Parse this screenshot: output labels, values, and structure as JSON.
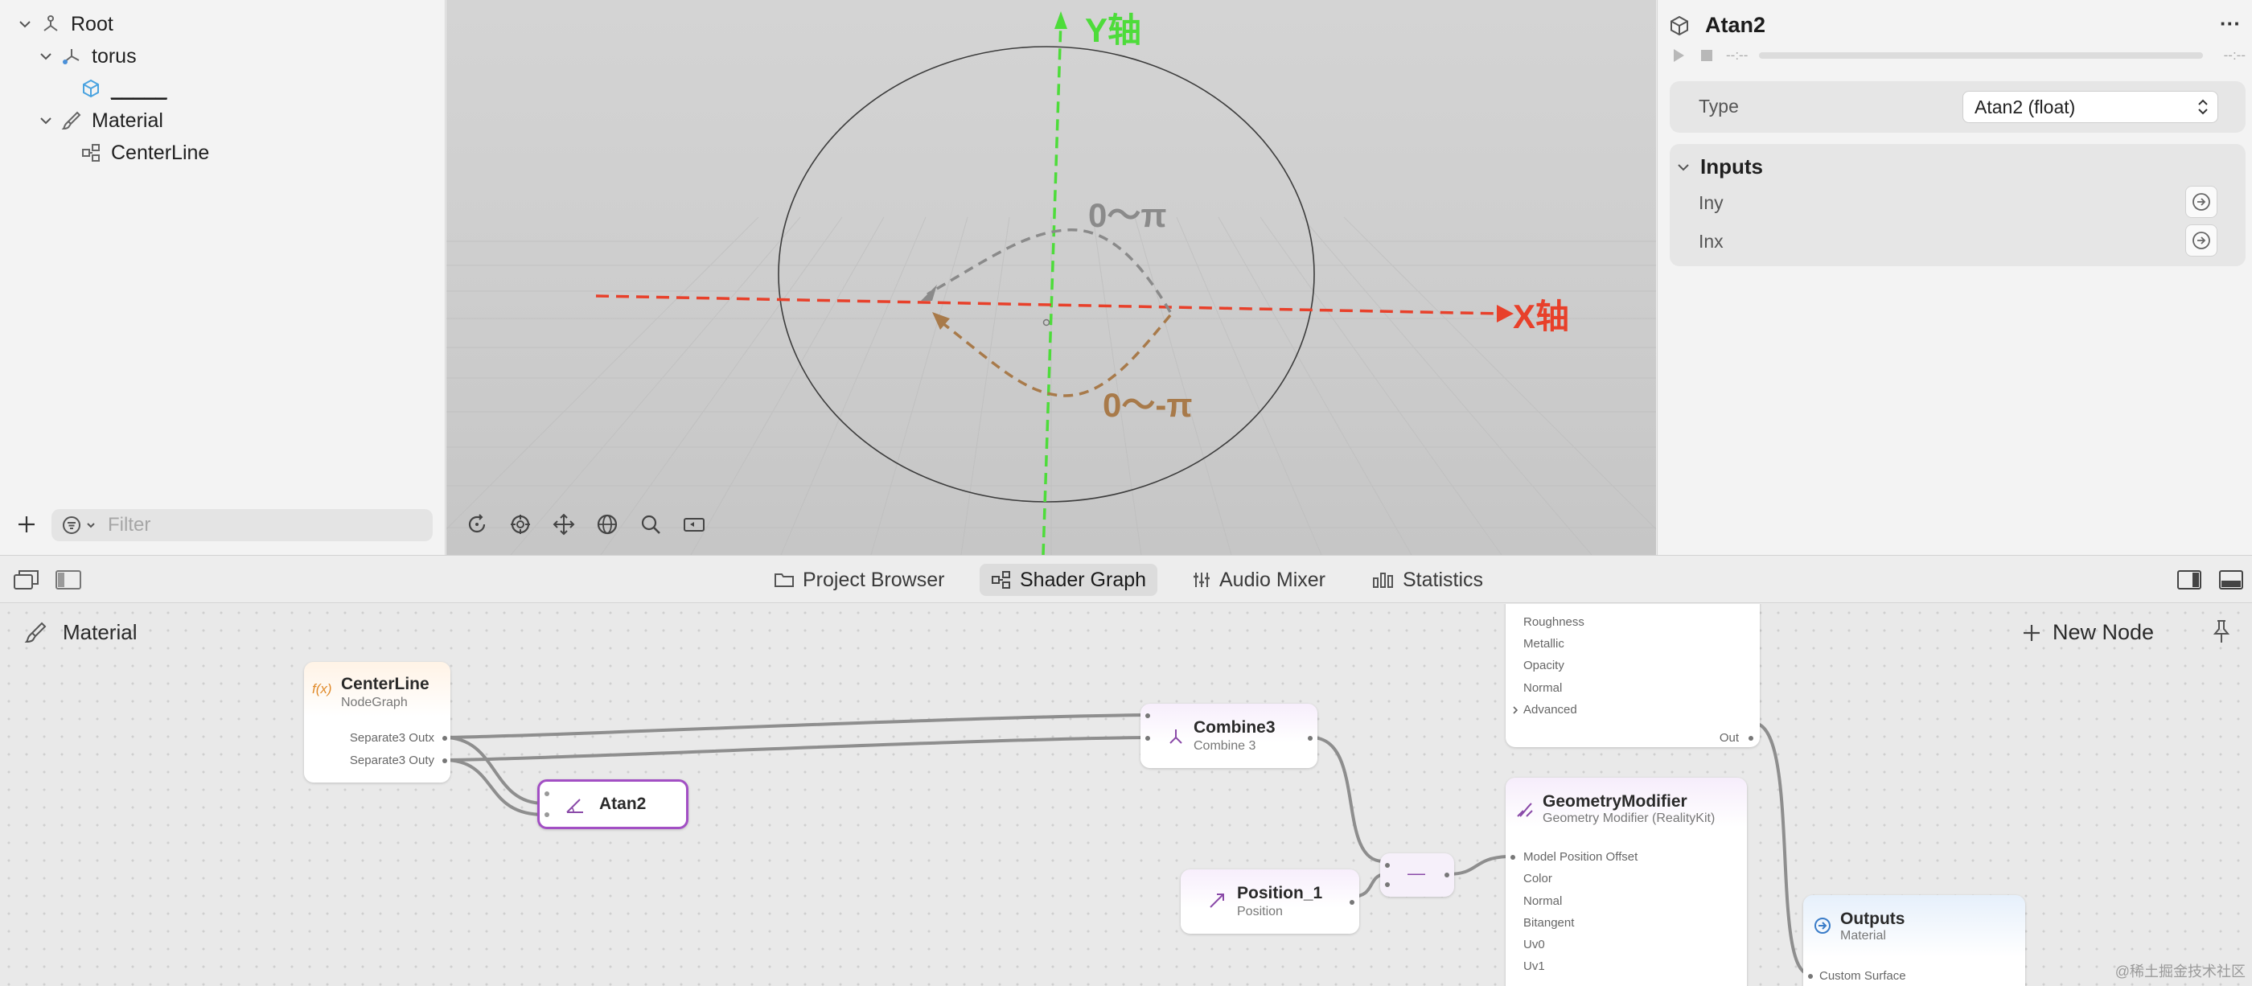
{
  "hierarchy": {
    "items": [
      {
        "label": "Root"
      },
      {
        "label": "torus"
      },
      {
        "label": "_____"
      },
      {
        "label": "Material"
      },
      {
        "label": "CenterLine"
      }
    ],
    "filter_placeholder": "Filter"
  },
  "viewport": {
    "y_axis_label": "Y轴",
    "x_axis_label": "X轴",
    "upper_range_label": "0～π",
    "lower_range_label": "0～-π",
    "colors": {
      "x_axis": "#e8402a",
      "y_axis": "#4ddc3a",
      "upper_arc": "#8a8a8a",
      "lower_arc": "#a87a4a"
    }
  },
  "inspector": {
    "title": "Atan2",
    "more_label": "···",
    "time_start": "--:--",
    "time_end": "--:--",
    "type_label": "Type",
    "type_value": "Atan2 (float)",
    "inputs_header": "Inputs",
    "inputs": [
      {
        "label": "Iny"
      },
      {
        "label": "Inx"
      }
    ]
  },
  "tabs": [
    {
      "label": "Project Browser"
    },
    {
      "label": "Shader Graph"
    },
    {
      "label": "Audio Mixer"
    },
    {
      "label": "Statistics"
    }
  ],
  "graph": {
    "breadcrumb": "Material",
    "new_node_label": "New Node",
    "nodes": {
      "centerline": {
        "icon_text": "f(x)",
        "title": "CenterLine",
        "subtitle": "NodeGraph",
        "ports": [
          "Separate3 Outx",
          "Separate3 Outy"
        ]
      },
      "atan2": {
        "title": "Atan2"
      },
      "combine3": {
        "title": "Combine3",
        "subtitle": "Combine 3"
      },
      "position": {
        "title": "Position_1",
        "subtitle": "Position"
      },
      "minus": {
        "symbol": "—"
      },
      "surface": {
        "ports": [
          "Roughness",
          "Metallic",
          "Opacity",
          "Normal",
          "Advanced"
        ],
        "out": "Out"
      },
      "geometry": {
        "title": "GeometryModifier",
        "subtitle": "Geometry Modifier (RealityKit)",
        "ports": [
          "Model Position Offset",
          "Color",
          "Normal",
          "Bitangent",
          "Uv0",
          "Uv1"
        ]
      },
      "outputs": {
        "title": "Outputs",
        "subtitle": "Material",
        "port": "Custom Surface"
      }
    }
  },
  "watermark": "@稀土掘金技术社区"
}
